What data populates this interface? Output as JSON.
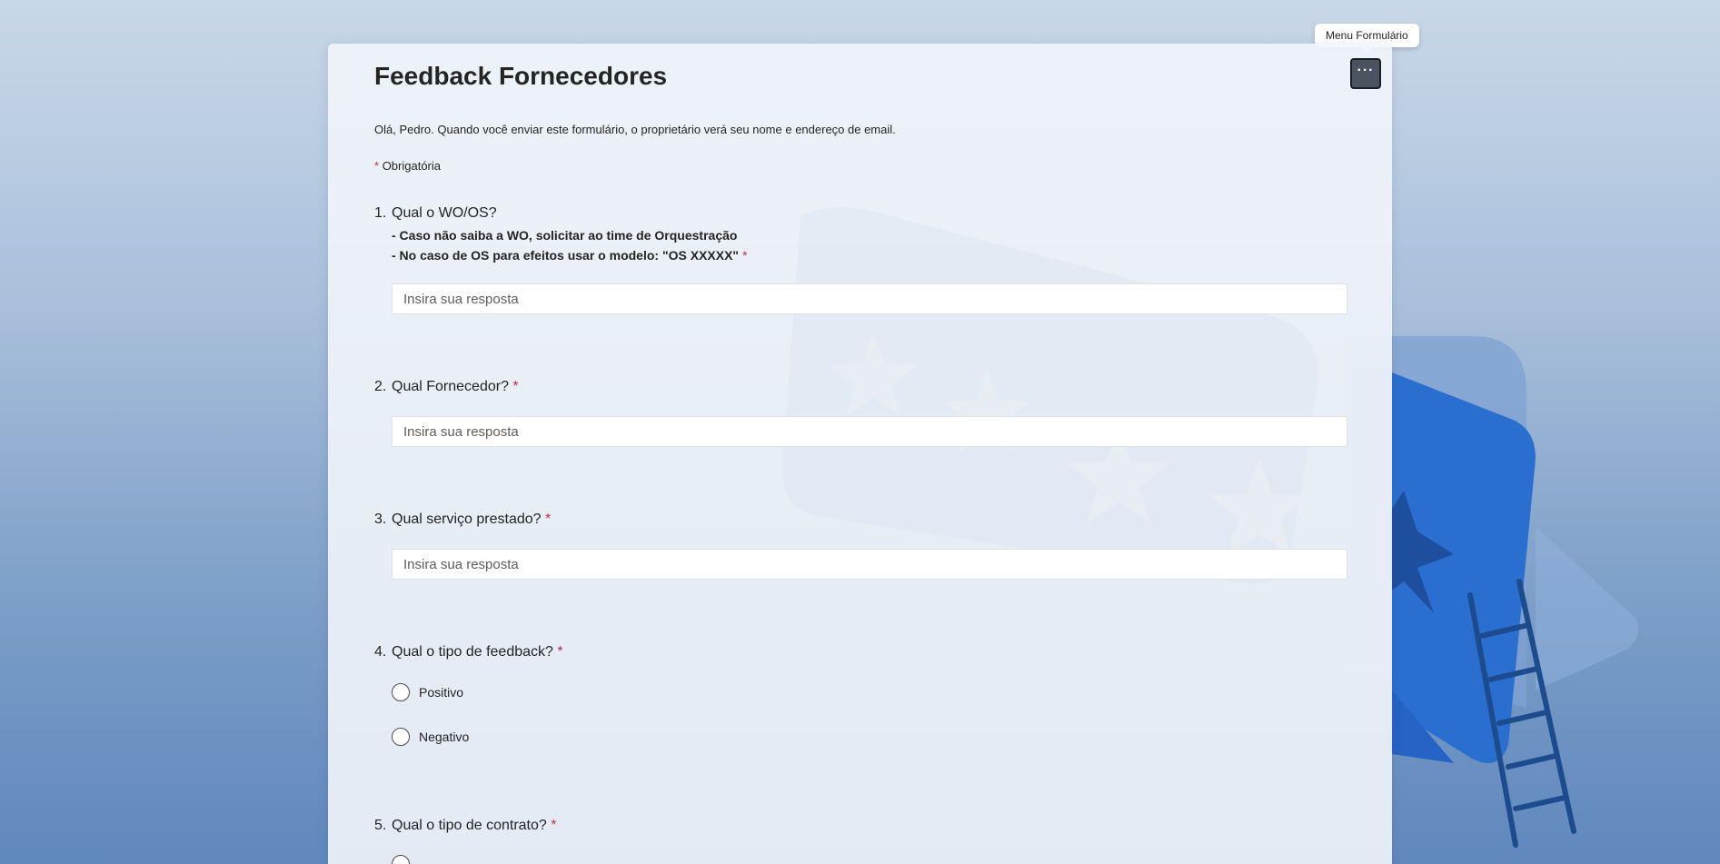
{
  "tooltip": {
    "text": "Menu Formulário"
  },
  "form": {
    "title": "Feedback Fornecedores",
    "menu_icon": "more-horizontal-icon",
    "menu_glyph": "···",
    "intro": "Olá, Pedro. Quando você enviar este formulário, o proprietário verá seu nome e endereço de email.",
    "required_mark": "*",
    "required_label": "Obrigatória"
  },
  "questions": [
    {
      "number": "1.",
      "title": "Qual o WO/OS?",
      "subtitle_lines": [
        "- Caso não saiba a WO, solicitar ao time de Orquestração",
        "- No caso de OS para efeitos usar o modelo: \"OS XXXXX\""
      ],
      "required": "*",
      "placeholder": "Insira sua resposta"
    },
    {
      "number": "2.",
      "title": "Qual Fornecedor?",
      "required": "*",
      "placeholder": "Insira sua resposta"
    },
    {
      "number": "3.",
      "title": "Qual serviço prestado?",
      "required": "*",
      "placeholder": "Insira sua resposta"
    },
    {
      "number": "4.",
      "title": "Qual o tipo de feedback?",
      "required": "*",
      "options": [
        "Positivo",
        "Negativo"
      ]
    },
    {
      "number": "5.",
      "title": "Qual o tipo de contrato?",
      "required": "*"
    }
  ],
  "colors": {
    "accent_required": "#c4314b",
    "card_bg": "#f2f5fa",
    "menu_button": "#4a5360",
    "background_top": "#c9d8e8",
    "background_bottom": "#5f88bd",
    "illustration_blue": "#2a6fd0"
  }
}
